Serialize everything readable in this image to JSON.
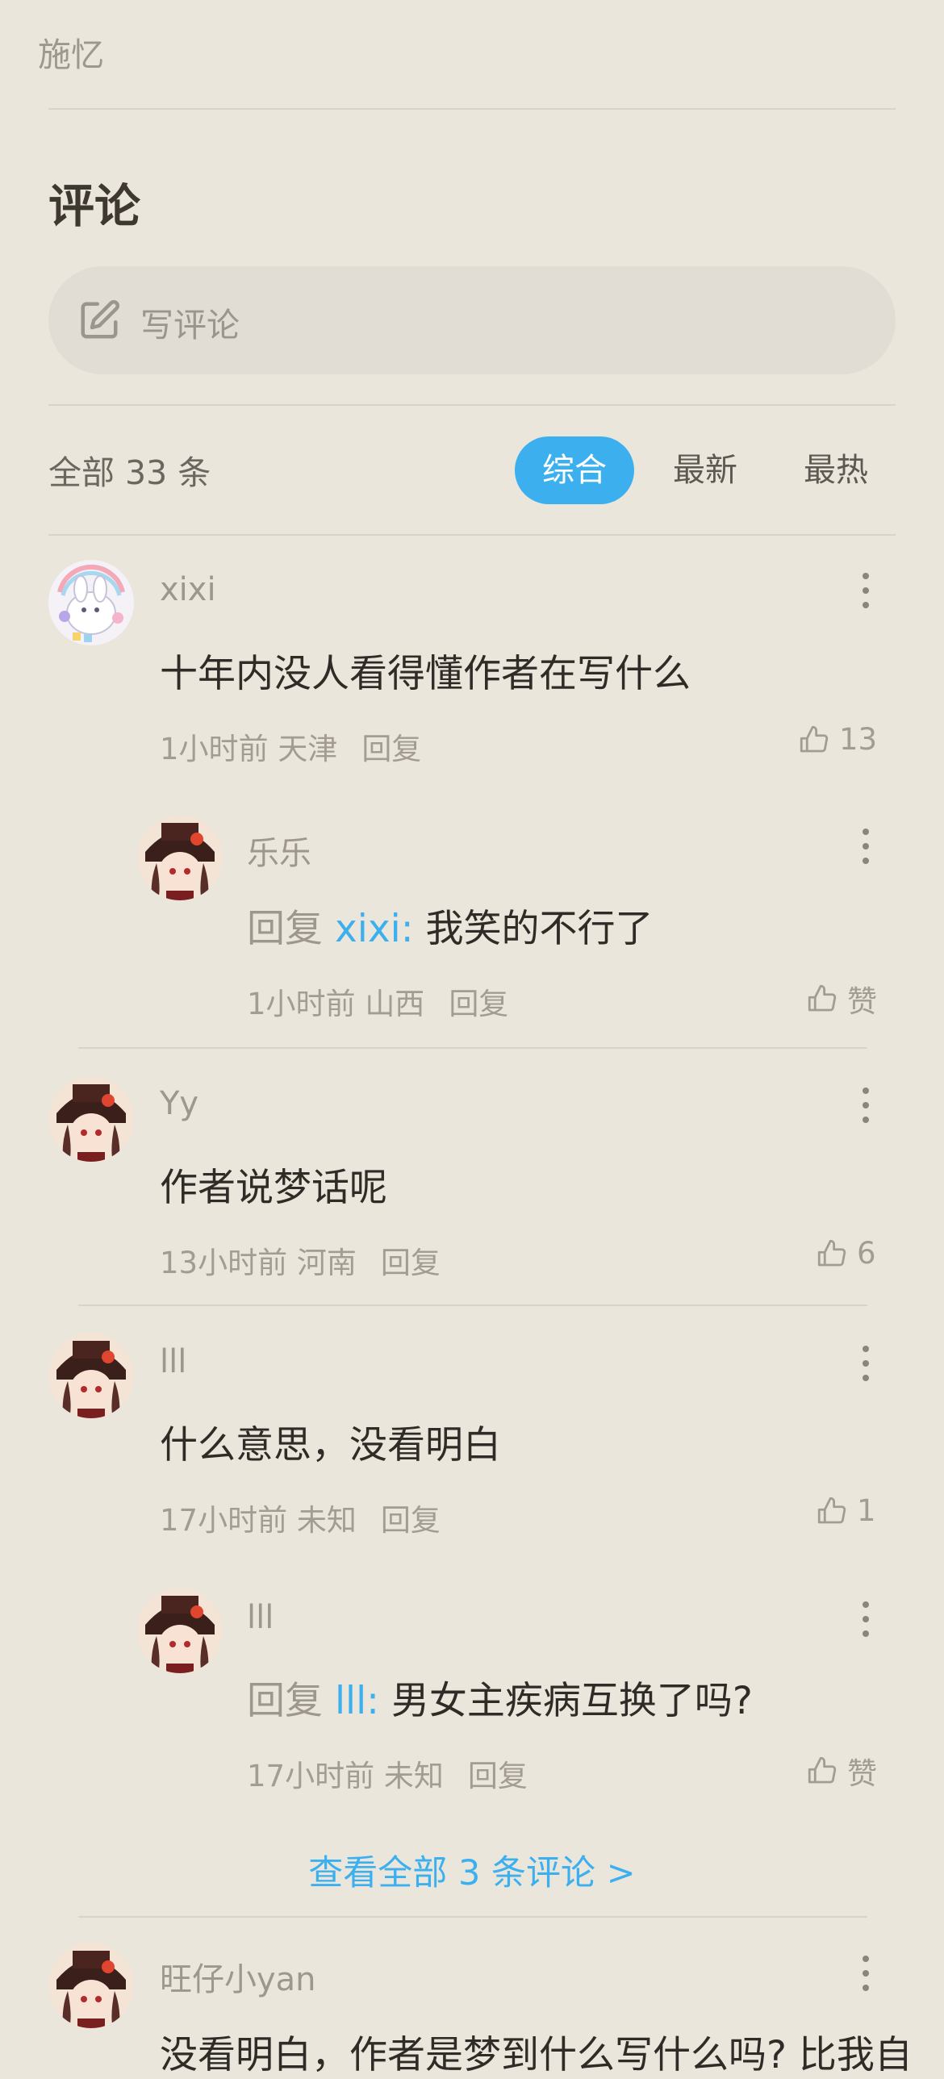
{
  "header": {
    "author": "施忆"
  },
  "comments_section": {
    "title": "评论",
    "write_placeholder": "写评论",
    "count_text": "全部 33 条",
    "tabs": [
      "综合",
      "最新",
      "最热"
    ],
    "active_tab": "综合"
  },
  "comments": [
    {
      "name": "xixi",
      "text": "十年内没人看得懂作者在写什么",
      "time": "1小时前",
      "location": "天津",
      "reply_label": "回复",
      "likes": "13",
      "replies": [
        {
          "name": "乐乐",
          "reply_prefix": "回复",
          "mention": "xixi",
          "text": "我笑的不行了",
          "time": "1小时前",
          "location": "山西",
          "reply_label": "回复",
          "likes": "赞"
        }
      ]
    },
    {
      "name": "Yy",
      "text": "作者说梦话呢",
      "time": "13小时前",
      "location": "河南",
      "reply_label": "回复",
      "likes": "6"
    },
    {
      "name": "lll",
      "text": "什么意思，没看明白",
      "time": "17小时前",
      "location": "未知",
      "reply_label": "回复",
      "likes": "1",
      "replies": [
        {
          "name": "lll",
          "reply_prefix": "回复",
          "mention": "lll",
          "text": "男女主疾病互换了吗?",
          "time": "17小时前",
          "location": "未知",
          "reply_label": "回复",
          "likes": "赞"
        }
      ],
      "view_all": "查看全部 3 条评论 >"
    },
    {
      "name": "旺仔小yan",
      "text": "没看明白，作者是梦到什么写什么吗? 比我自"
    }
  ],
  "colors": {
    "accent": "#3cb0ef",
    "background": "#ebe6dc"
  }
}
